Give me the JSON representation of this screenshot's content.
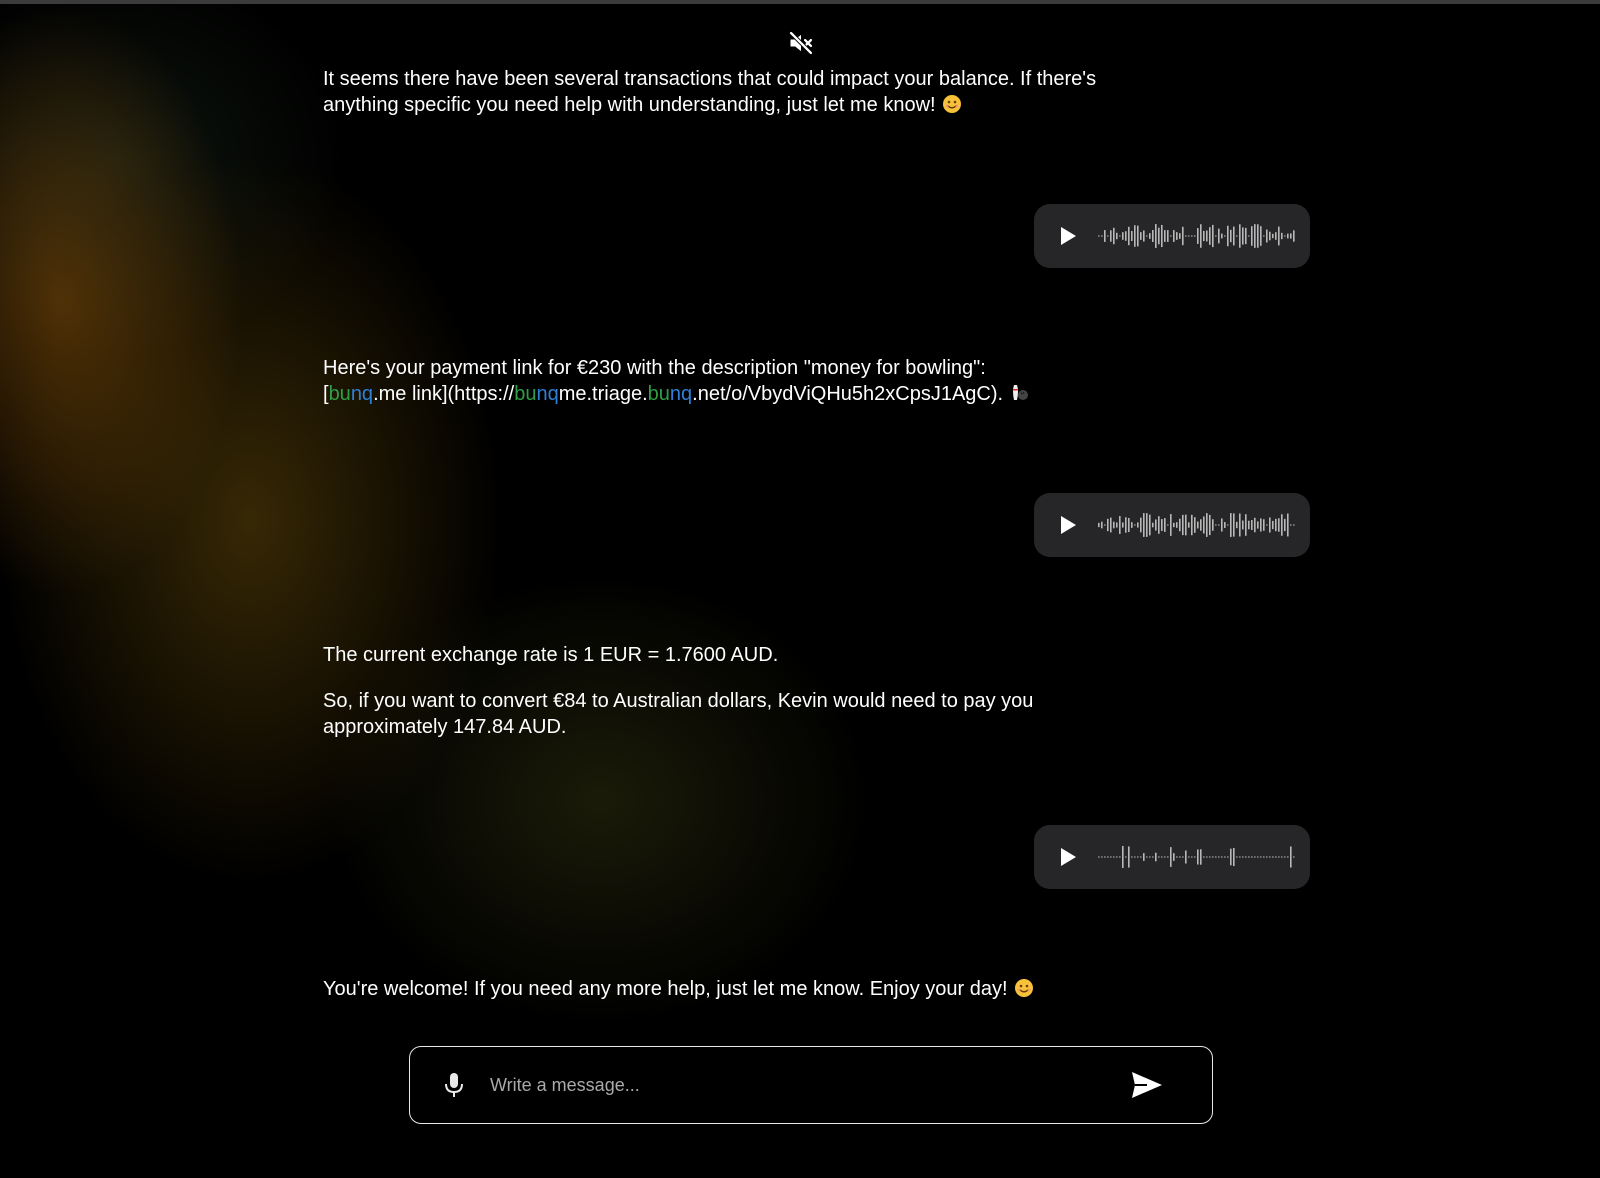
{
  "header": {
    "mute_icon": "speaker-muted-icon"
  },
  "messages": [
    {
      "role": "assistant",
      "text": "It seems there have been several transactions that could impact your balance. If there's anything specific you need help with understanding, just let me know!",
      "emoji": "smiling-face-emoji"
    },
    {
      "role": "user",
      "type": "voice",
      "play_icon": "play-icon"
    },
    {
      "role": "assistant",
      "line1": "Here's your payment link for €230 with the description \"money for bowling\":",
      "line2_parts": [
        "[",
        "bu",
        "nq",
        ".me link](https://",
        "bu",
        "nq",
        "me.triage.",
        "bu",
        "nq",
        ".net/o/VbydViQHu5h2xCpsJ1AgC)."
      ],
      "emoji": "bowling-emoji"
    },
    {
      "role": "user",
      "type": "voice",
      "play_icon": "play-icon"
    },
    {
      "role": "assistant",
      "para1": "The current exchange rate is 1 EUR = 1.7600 AUD.",
      "para2": "So, if you want to convert €84 to Australian dollars, Kevin would need to pay you approximately 147.84 AUD."
    },
    {
      "role": "user",
      "type": "voice",
      "play_icon": "play-icon"
    },
    {
      "role": "assistant",
      "text": "You're welcome! If you need any more help, just let me know. Enjoy your day!",
      "emoji": "smiling-face-emoji"
    }
  ],
  "composer": {
    "placeholder": "Write a message...",
    "value": "",
    "mic_icon": "microphone-icon",
    "send_icon": "send-icon"
  },
  "colors": {
    "background": "#000000",
    "bubble": "#262628",
    "brand_green": "#2f9e44",
    "brand_blue": "#2f7fd6",
    "text": "#ffffff"
  }
}
